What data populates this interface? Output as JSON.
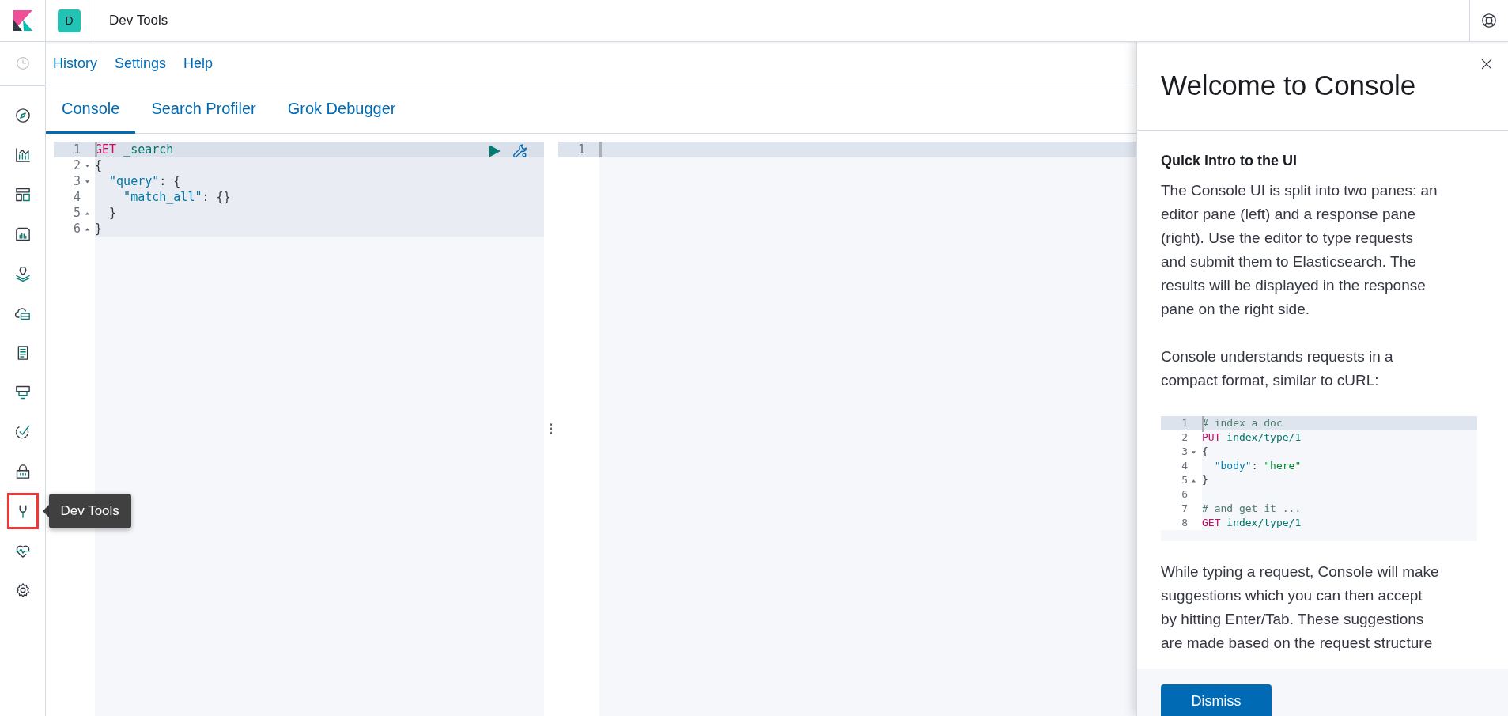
{
  "header": {
    "space_avatar": "D",
    "title": "Dev Tools"
  },
  "recent_button": {
    "disabled": true
  },
  "sidebar": {
    "items": [
      {
        "selected": false
      },
      {
        "selected": false
      },
      {
        "selected": false
      },
      {
        "selected": false
      },
      {
        "selected": false
      },
      {
        "selected": false
      },
      {
        "selected": false
      },
      {
        "selected": false
      },
      {
        "selected": false
      },
      {
        "selected": false
      },
      {
        "selected": true
      },
      {
        "selected": false
      },
      {
        "selected": false
      }
    ],
    "tooltip": "Dev Tools"
  },
  "nav_links": [
    "History",
    "Settings",
    "Help"
  ],
  "tabs": [
    {
      "label": "Console",
      "selected": true
    },
    {
      "label": "Search Profiler",
      "selected": false
    },
    {
      "label": "Grok Debugger",
      "selected": false
    }
  ],
  "request_editor": {
    "lines": [
      {
        "number": "1",
        "kind": "plain",
        "active": true,
        "highlighted": true,
        "tokens": [
          {
            "text": "GET",
            "kind": "method"
          },
          {
            "text": " _search",
            "kind": "url"
          }
        ]
      },
      {
        "number": "2",
        "kind": "start",
        "active": false,
        "highlighted": true,
        "tokens": [
          {
            "text": "{",
            "kind": "punct"
          }
        ]
      },
      {
        "number": "3",
        "kind": "start",
        "active": false,
        "highlighted": true,
        "tokens": [
          {
            "text": "  \"query\"",
            "kind": "key"
          },
          {
            "text": ": {",
            "kind": "punct"
          }
        ]
      },
      {
        "number": "4",
        "kind": "plain",
        "active": false,
        "highlighted": true,
        "tokens": [
          {
            "text": "    \"match_all\"",
            "kind": "key"
          },
          {
            "text": ": {}",
            "kind": "punct"
          }
        ]
      },
      {
        "number": "5",
        "kind": "end",
        "active": false,
        "highlighted": true,
        "tokens": [
          {
            "text": "  }",
            "kind": "punct"
          }
        ]
      },
      {
        "number": "6",
        "kind": "end",
        "active": false,
        "highlighted": true,
        "tokens": [
          {
            "text": "}",
            "kind": "punct"
          }
        ]
      }
    ]
  },
  "response_editor": {
    "lines": [
      {
        "number": "1",
        "active": true
      }
    ]
  },
  "flyout": {
    "title": "Welcome to Console",
    "heading": "Quick intro to the UI",
    "paragraphs": [
      "The Console UI is split into two panes: an editor pane (left) and a response pane (right). Use the editor to type requests and submit them to Elasticsearch. The results will be displayed in the response pane on the right side.",
      "Console understands requests in a compact format, similar to cURL:"
    ],
    "example": {
      "lines": [
        {
          "number": "1",
          "kind": "plain",
          "active": true,
          "highlighted": false,
          "tokens": [
            {
              "text": "# index a doc",
              "kind": "comment"
            }
          ]
        },
        {
          "number": "2",
          "kind": "plain",
          "active": false,
          "highlighted": false,
          "tokens": [
            {
              "text": "PUT",
              "kind": "method"
            },
            {
              "text": " index/type/1",
              "kind": "url"
            }
          ]
        },
        {
          "number": "3",
          "kind": "start",
          "active": false,
          "highlighted": false,
          "tokens": [
            {
              "text": "{",
              "kind": "punct"
            }
          ]
        },
        {
          "number": "4",
          "kind": "plain",
          "active": false,
          "highlighted": false,
          "tokens": [
            {
              "text": "  \"body\"",
              "kind": "key"
            },
            {
              "text": ": ",
              "kind": "punct"
            },
            {
              "text": "\"here\"",
              "kind": "string"
            }
          ]
        },
        {
          "number": "5",
          "kind": "end",
          "active": false,
          "highlighted": false,
          "tokens": [
            {
              "text": "}",
              "kind": "punct"
            }
          ]
        },
        {
          "number": "6",
          "kind": "plain",
          "active": false,
          "highlighted": false
        },
        {
          "number": "7",
          "kind": "plain",
          "active": false,
          "highlighted": false,
          "tokens": [
            {
              "text": "# and get it ...",
              "kind": "comment"
            }
          ]
        },
        {
          "number": "8",
          "kind": "plain",
          "active": false,
          "highlighted": false,
          "tokens": [
            {
              "text": "GET",
              "kind": "method"
            },
            {
              "text": " index/type/1",
              "kind": "url"
            }
          ]
        }
      ]
    },
    "after_paragraph": "While typing a request, Console will make suggestions which you can then accept by hitting Enter/Tab. These suggestions are made based on the request structure",
    "dismiss_button": "Dismiss"
  }
}
